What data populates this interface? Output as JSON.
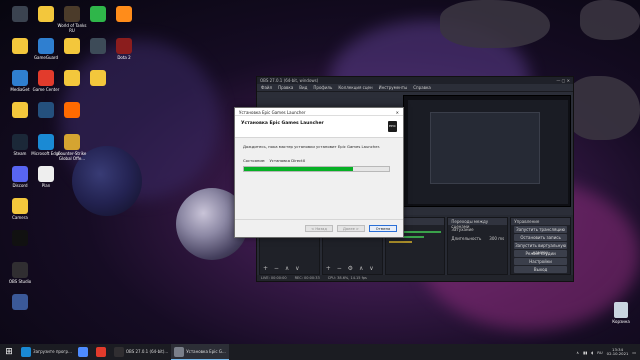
{
  "desktop": {
    "icons": [
      {
        "label": "",
        "color": "#3b4350"
      },
      {
        "label": "",
        "color": "#f3c73c"
      },
      {
        "label": "World of Tanks RU",
        "color": "#4b3b2a"
      },
      {
        "label": "",
        "color": "#2fb64a"
      },
      {
        "label": "",
        "color": "#ff8c1a"
      },
      {
        "label": "",
        "color": "#f3c73c"
      },
      {
        "label": "GameGuard",
        "color": "#2f7fd0"
      },
      {
        "label": "",
        "color": "#f3c73c"
      },
      {
        "label": "",
        "color": "#3d4b58"
      },
      {
        "label": "Dota 2",
        "color": "#8b1d1d"
      },
      {
        "label": "MediaGet",
        "color": "#2f7fd0"
      },
      {
        "label": "Game Center",
        "color": "#e23b2c"
      },
      {
        "label": "",
        "color": "#f3c73c"
      },
      {
        "label": "",
        "color": "#f3c73c"
      },
      {
        "label": "",
        "color": "#f3c73c"
      },
      {
        "label": "",
        "color": "#24507d"
      },
      {
        "label": "",
        "color": "#ff6a00"
      },
      {
        "label": "Steam",
        "color": "#1b2838"
      },
      {
        "label": "Microsoft Edge",
        "color": "#1a8ad4"
      },
      {
        "label": "Counter-Strike Global Offe...",
        "color": "#d5a431"
      },
      {
        "label": "Discord",
        "color": "#5865f2"
      },
      {
        "label": "Plan",
        "color": "#eeeeee"
      },
      {
        "label": "Camera",
        "color": "#f3c73c"
      },
      {
        "label": "",
        "color": "#111111"
      },
      {
        "label": "OBS Studio",
        "color": "#302e31"
      },
      {
        "label": "",
        "color": "#3b5998"
      }
    ],
    "recycle_bin": "Корзина"
  },
  "obs": {
    "title": "OBS 27.0.1 (64-bit, windows)",
    "menu": [
      "Файл",
      "Правка",
      "Вид",
      "Профиль",
      "Коллекция сцен",
      "Инструменты",
      "Справка"
    ],
    "docks": {
      "scenes_header": "",
      "sources_header": "",
      "audio_header": "",
      "transitions_header": "Переходы между сценами",
      "transition_value": "Затухание",
      "duration_label": "Длительность",
      "duration_value": "300 ms",
      "controls_header": "Управление",
      "controls": [
        "Запустить трансляцию",
        "Остановить запись",
        "Запустить виртуальную камеру",
        "Режим студии",
        "Настройки",
        "Выход"
      ]
    },
    "status": {
      "live": "LIVE: 00:00:00",
      "rec": "REC: 00:00:33",
      "cpu": "CPU: 38.6%, 14.15 fps"
    }
  },
  "installer": {
    "window_title": "Установка Epic Games Launcher",
    "header": "Установка Epic Games Launcher",
    "message": "Дождитесь, пока мастер установки установит Epic Games Launcher.",
    "status_label": "Состояние:",
    "status_value": "Установка DirectX",
    "progress": 0.75,
    "buttons": {
      "back": "< Назад",
      "next": "Далее >",
      "cancel": "Отмена"
    }
  },
  "taskbar": {
    "items": [
      {
        "label": "Загрузите прогр...",
        "color": "#1a8ad4",
        "active": false
      },
      {
        "label": "",
        "color": "#4e8cff",
        "active": false
      },
      {
        "label": "",
        "color": "#e23b2c",
        "active": false
      },
      {
        "label": "OBS 27.0.1 (64-bit)...",
        "color": "#302e31",
        "active": false
      },
      {
        "label": "Установка Epic G...",
        "color": "#7a7f8a",
        "active": true
      }
    ],
    "tray": {
      "lang": "RU",
      "time": "13:34",
      "date": "02.10.2021"
    }
  },
  "colors": {
    "progress": "#06b025",
    "accent": "#76b9ed"
  }
}
